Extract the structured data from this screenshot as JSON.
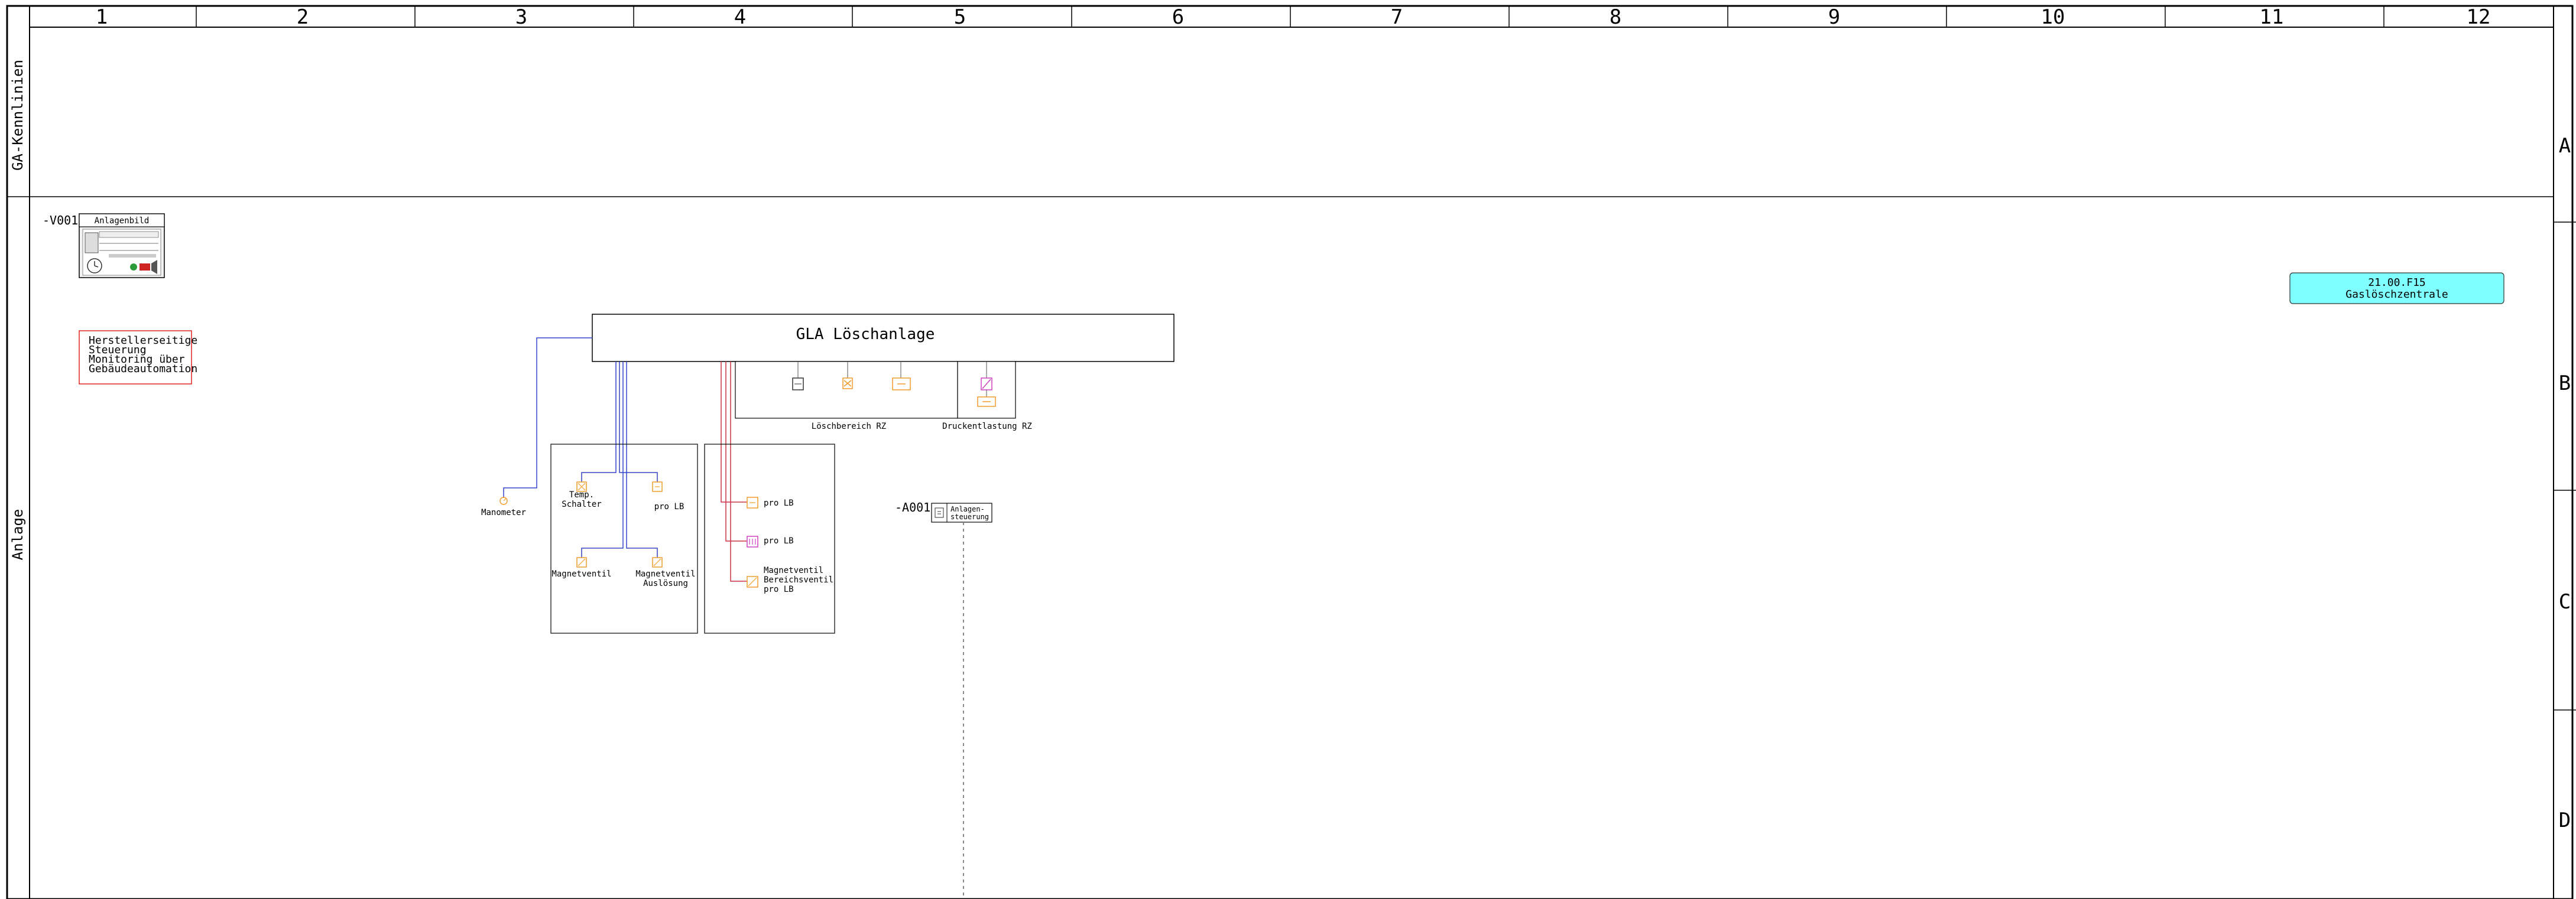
{
  "grid": {
    "columns": [
      "1",
      "2",
      "3",
      "4",
      "5",
      "6",
      "7",
      "8",
      "9",
      "10",
      "11",
      "12"
    ],
    "rows": [
      "A",
      "B",
      "C",
      "D"
    ],
    "side_labels": [
      "GA-Kennlinien",
      "Anlage"
    ]
  },
  "panel": {
    "tag": "-V001",
    "title": "Anlagenbild"
  },
  "note": {
    "lines": [
      "Herstellerseitige",
      "Steuerung",
      "Monitoring über",
      "Gebäudeautomation"
    ]
  },
  "main_box": {
    "title": "GLA Löschanlage"
  },
  "labels": {
    "loeschbereich": "Löschbereich RZ",
    "druckentlastung": "Druckentlastung RZ",
    "manometer": "Manometer",
    "temp_schalter_1": "Temp.",
    "temp_schalter_2": "Schalter",
    "pro_lb_1": "pro LB",
    "magnetventil": "Magnetventil",
    "magnetventil_ausl_1": "Magnetventil",
    "magnetventil_ausl_2": "Auslösung",
    "pro_lb_2": "pro LB",
    "pro_lb_3": "pro LB",
    "mv_bereich_1": "Magnetventil",
    "mv_bereich_2": "Bereichsventil",
    "mv_bereich_3": "pro LB"
  },
  "controller": {
    "tag": "-A001",
    "label_1": "Anlagen-",
    "label_2": "steuerung"
  },
  "location_box": {
    "code": "21.00.F15",
    "name": "Gaslöschzentrale",
    "color": "#7fffff"
  },
  "colors": {
    "blue_line": "#3344cc",
    "red_line": "#cc3344",
    "orange_symbol": "#f39c2c",
    "magenta_symbol": "#d040c0",
    "red_note_border": "#dd2222"
  }
}
